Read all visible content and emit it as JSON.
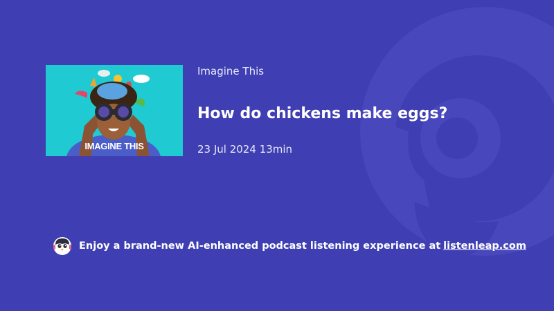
{
  "podcast": {
    "show_name": "Imagine This",
    "episode_title": "How do chickens make eggs?",
    "date": "23 Jul 2024",
    "duration": "13min",
    "cover_text": "IMAGINE THIS"
  },
  "promo": {
    "text": "Enjoy a brand-new AI-enhanced podcast listening experience at",
    "link_text": "listenleap.com",
    "icon": "penguin-mascot-icon"
  },
  "colors": {
    "background": "#3f3fb3",
    "cover_background": "#1fcad2",
    "text_primary": "#ffffff",
    "text_secondary": "#e6e7fa"
  }
}
